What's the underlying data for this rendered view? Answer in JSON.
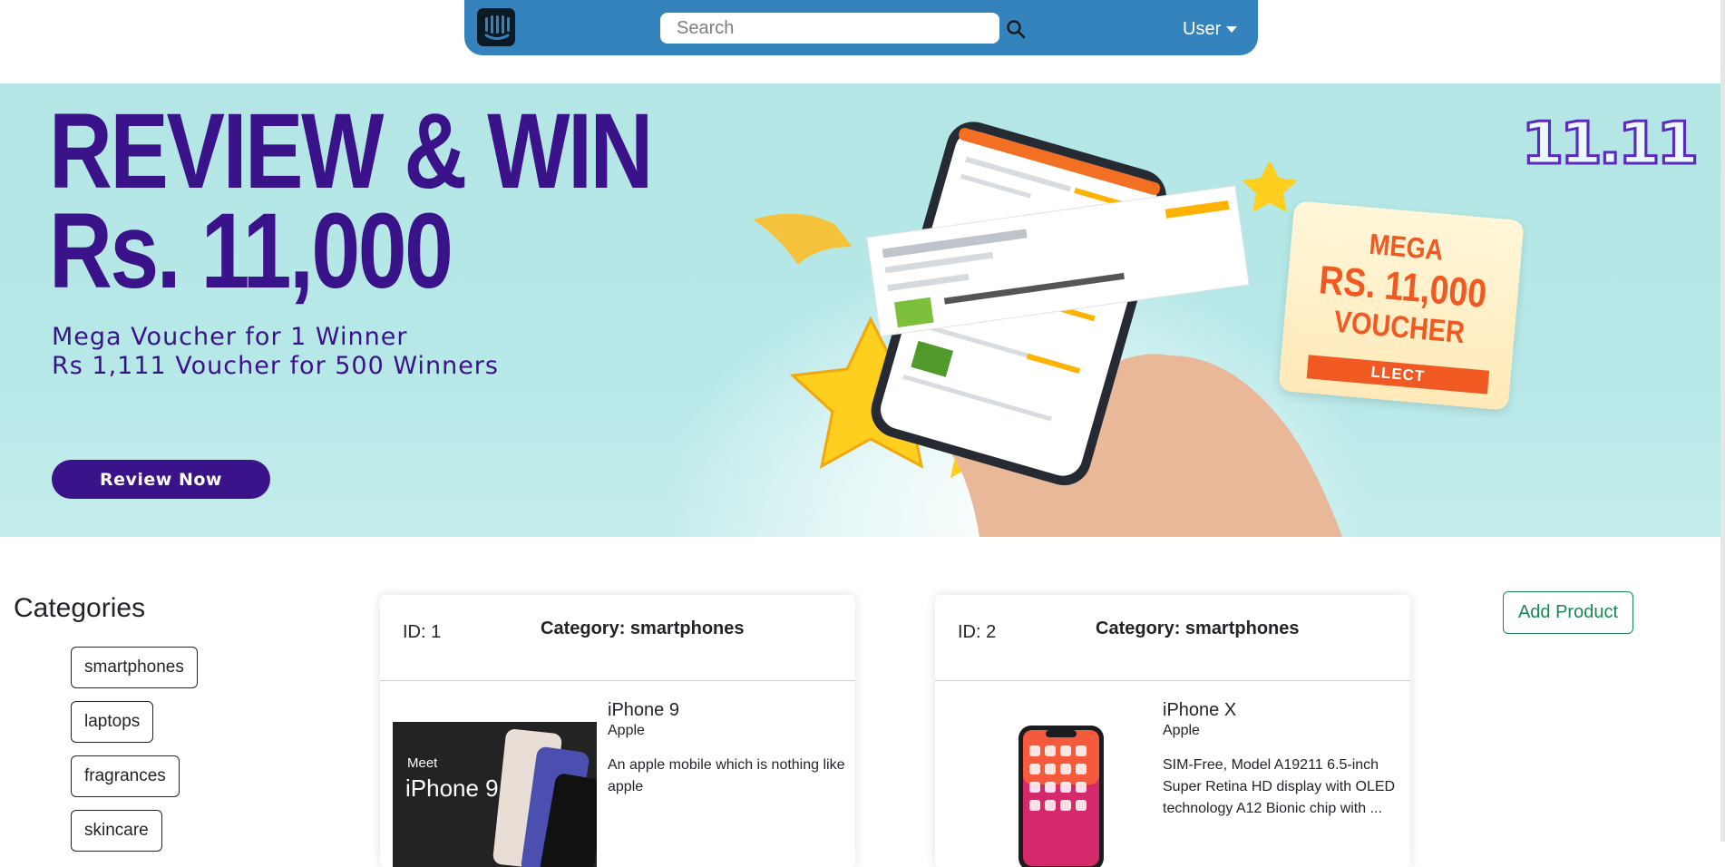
{
  "navbar": {
    "search_placeholder": "Search",
    "user_label": "User"
  },
  "banner": {
    "headline_line1": "REVIEW & WIN",
    "headline_line2": "Rs. 11,000",
    "subline1": "Mega Voucher for 1 Winner",
    "subline2": "Rs 1,111 Voucher for 500 Winners",
    "cta_label": "Review Now",
    "badge": "11.11",
    "voucher_line1": "MEGA",
    "voucher_line2": "RS. 11,000",
    "voucher_line3": "VOUCHER",
    "voucher_collect": "LLECT"
  },
  "categories": {
    "title": "Categories",
    "items": [
      "smartphones",
      "laptops",
      "fragrances",
      "skincare"
    ]
  },
  "products": [
    {
      "id_label": "ID: 1",
      "category_label": "Category: smartphones",
      "title": "iPhone 9",
      "brand": "Apple",
      "description": "An apple mobile which is nothing like apple",
      "image_text_line1": "Meet",
      "image_text_line2": "iPhone 9"
    },
    {
      "id_label": "ID: 2",
      "category_label": "Category: smartphones",
      "title": "iPhone X",
      "brand": "Apple",
      "description": "SIM-Free, Model A19211 6.5-inch Super Retina HD display with OLED technology A12 Bionic chip with ..."
    }
  ],
  "actions": {
    "add_product_label": "Add Product"
  },
  "colors": {
    "navbar": "#3483bd",
    "banner_bg": "#b3e6e5",
    "banner_text": "#3a1289",
    "add_button": "#198754"
  },
  "icons": {
    "logo": "intercom-logo-icon",
    "search": "search-icon",
    "user_caret": "caret-down-icon"
  }
}
